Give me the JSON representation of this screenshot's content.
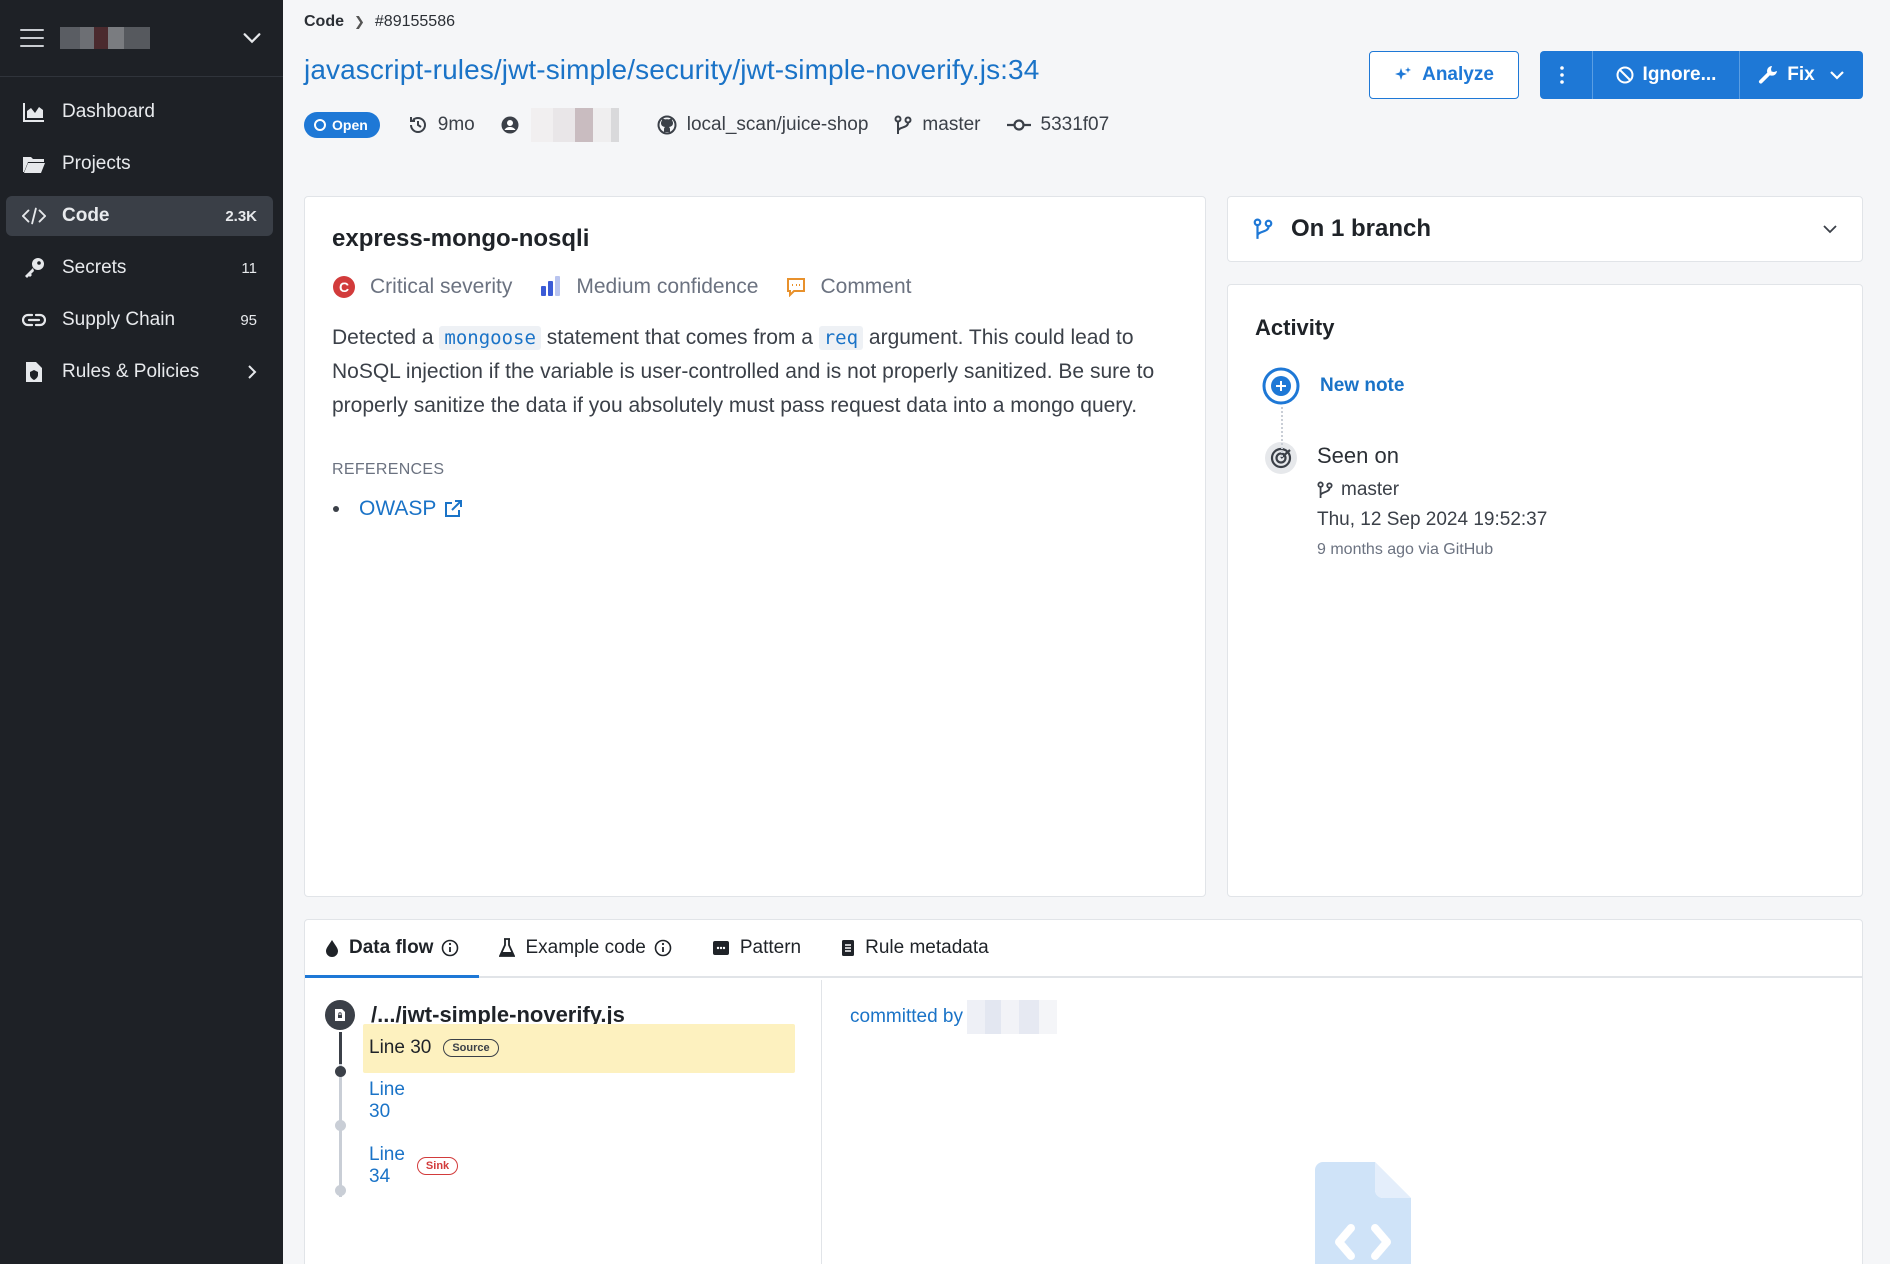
{
  "sidebar": {
    "items": [
      {
        "label": "Dashboard",
        "count": ""
      },
      {
        "label": "Projects",
        "count": ""
      },
      {
        "label": "Code",
        "count": "2.3K"
      },
      {
        "label": "Secrets",
        "count": "11"
      },
      {
        "label": "Supply Chain",
        "count": "95"
      },
      {
        "label": "Rules & Policies",
        "count": ""
      }
    ]
  },
  "breadcrumb": {
    "section": "Code",
    "id": "#89155586"
  },
  "finding": {
    "title": "javascript-rules/jwt-simple/security/jwt-simple-noverify.js:34",
    "status": "Open",
    "age": "9mo",
    "repo": "local_scan/juice-shop",
    "branch": "master",
    "commit": "5331f07"
  },
  "actions": {
    "analyze": "Analyze",
    "ignore": "Ignore...",
    "fix": "Fix"
  },
  "rule": {
    "name": "express-mongo-nosqli",
    "severity": "Critical severity",
    "confidence": "Medium confidence",
    "comment": "Comment",
    "desc_1": "Detected a",
    "code_1": "mongoose",
    "desc_2": "statement that comes from a",
    "code_2": "req",
    "desc_3": "argument. This could lead to NoSQL injection if the variable is user-controlled and is not properly sanitized. Be sure to properly sanitize the data if you absolutely must pass request data into a mongo query.",
    "references_title": "REFERENCES",
    "references": [
      "OWASP"
    ]
  },
  "branch_card": {
    "label": "On 1 branch"
  },
  "activity": {
    "title": "Activity",
    "new_note": "New note",
    "seen_title": "Seen on",
    "seen_branch": "master",
    "seen_date": "Thu, 12 Sep 2024 19:52:37",
    "seen_via": "9 months ago via GitHub"
  },
  "tabs": [
    "Data flow",
    "Example code",
    "Pattern",
    "Rule metadata"
  ],
  "dataflow": {
    "file": "/.../jwt-simple-noverify.js",
    "steps": [
      {
        "label": "Line 30",
        "tag": "Source"
      },
      {
        "label": "Line 30",
        "tag": ""
      },
      {
        "label": "Line 34",
        "tag": "Sink"
      }
    ],
    "committed_by": "committed by"
  },
  "colors": {
    "accent": "#1e78d6",
    "sidebar": "#1e2126",
    "critical": "#d23b3b",
    "highlight": "#fdf1bf"
  }
}
